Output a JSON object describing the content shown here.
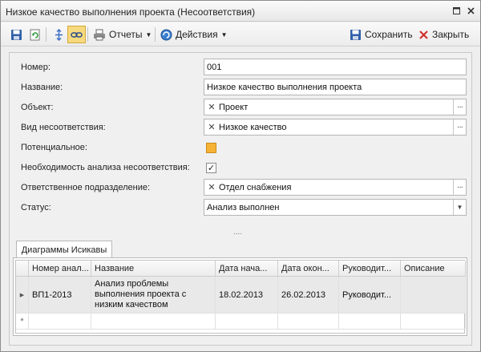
{
  "window": {
    "title": "Низкое качество выполнения проекта (Несоответствия)"
  },
  "toolbar": {
    "reports_label": "Отчеты",
    "actions_label": "Действия",
    "save_label": "Сохранить",
    "close_label": "Закрыть"
  },
  "form": {
    "number_label": "Номер:",
    "number_value": "001",
    "name_label": "Название:",
    "name_value": "Низкое качество выполнения проекта",
    "object_label": "Объект:",
    "object_value": "Проект",
    "type_label": "Вид несоответствия:",
    "type_value": "Низкое качество",
    "potential_label": "Потенциальное:",
    "analysis_label": "Необходимость анализа несоответствия:",
    "department_label": "Ответственное подразделение:",
    "department_value": "Отдел снабжения",
    "status_label": "Статус:",
    "status_value": "Анализ выполнен",
    "splitter": "....",
    "potential_checked": false,
    "analysis_checked": true
  },
  "tabs": [
    {
      "label": "Диаграммы Исикавы",
      "active": true
    }
  ],
  "grid": {
    "columns": [
      "Номер анал...",
      "Название",
      "Дата нача...",
      "Дата окон...",
      "Руководит...",
      "Описание"
    ],
    "rows": [
      {
        "number": "ВП1-2013",
        "name": "Анализ проблемы выполнения проекта с низким качеством",
        "start_date": "18.02.2013",
        "end_date": "26.02.2013",
        "manager": "Руководит...",
        "description": ""
      }
    ],
    "new_row_marker": "*"
  }
}
